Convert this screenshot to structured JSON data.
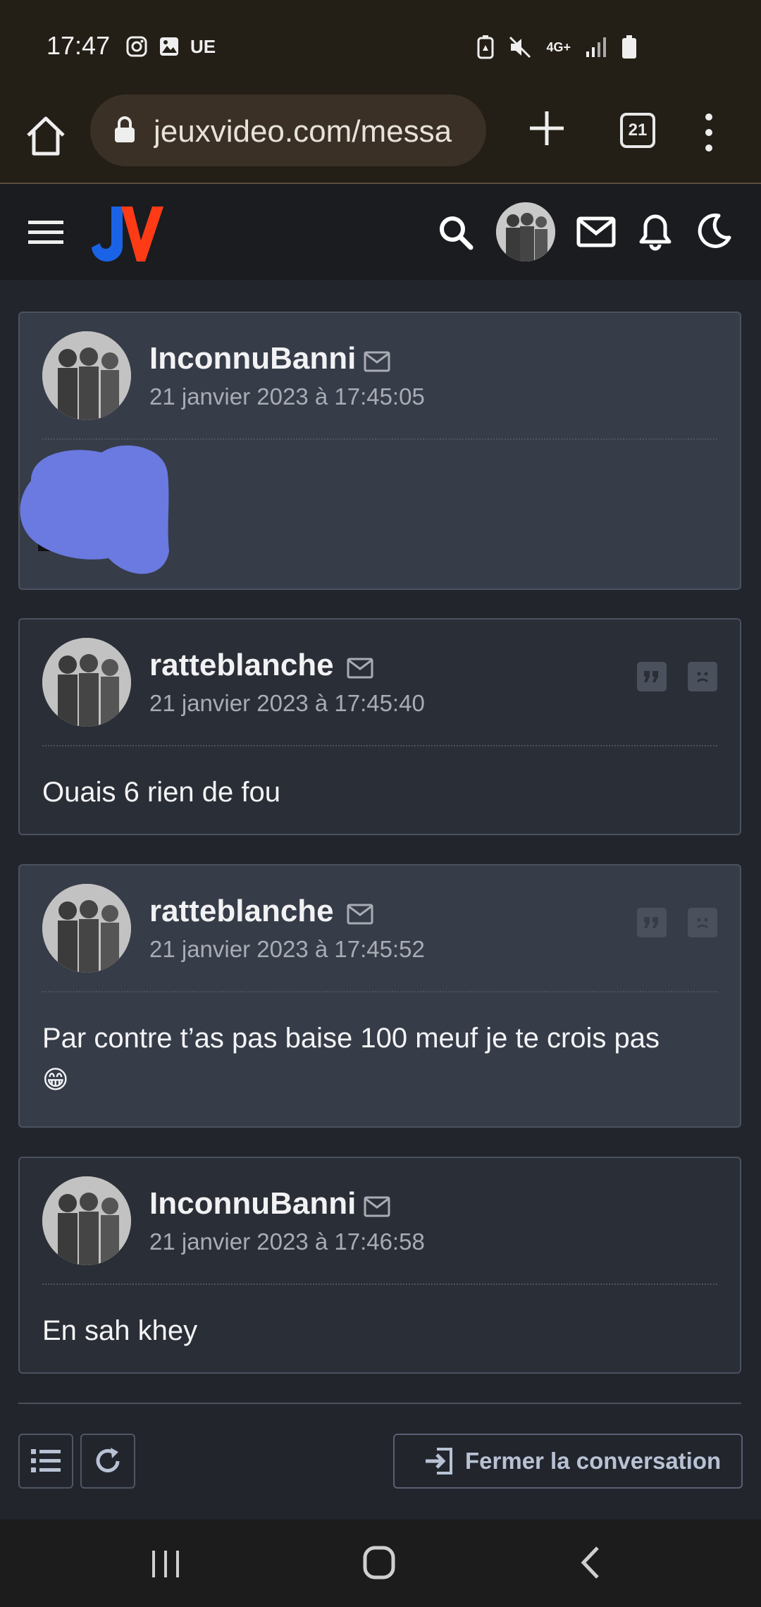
{
  "status_bar": {
    "time": "17:47",
    "carrier_tag": "UE",
    "network": "4G+",
    "icons_left": [
      "instagram-icon",
      "gallery-icon"
    ],
    "icons_right": [
      "battery-saver-icon",
      "mute-icon",
      "network-4g-icon",
      "signal-icon",
      "battery-icon"
    ]
  },
  "browser": {
    "url": "jeuxvideo.com/messa",
    "tab_count": "21"
  },
  "site_header": {
    "logo_text": "JV",
    "colors": {
      "logo_j": "#1a63e6",
      "logo_v": "#ff3b16"
    }
  },
  "posts": [
    {
      "author": "InconnuBanni",
      "date": "21 janvier 2023 à 17:45:05",
      "body": "",
      "redacted": true,
      "highlighted": true,
      "actions": false
    },
    {
      "author": "ratteblanche",
      "date": "21 janvier 2023 à 17:45:40",
      "body": "Ouais 6 rien de fou",
      "highlighted": false,
      "actions": true
    },
    {
      "author": "ratteblanche",
      "date": "21 janvier 2023 à 17:45:52",
      "body": "Par contre t’as pas baise 100 meuf je te crois pas",
      "emoji": "😁",
      "highlighted": true,
      "actions": true
    },
    {
      "author": "InconnuBanni",
      "date": "21 janvier 2023 à 17:46:58",
      "body": "En sah khey",
      "highlighted": false,
      "actions": false
    }
  ],
  "footer": {
    "close_label": "Fermer la conversation"
  }
}
